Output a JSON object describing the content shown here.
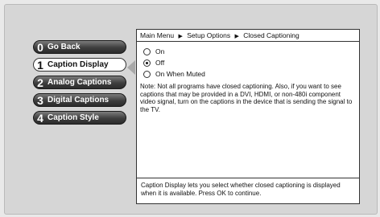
{
  "menu": {
    "items": [
      {
        "number": "0",
        "label": "Go Back"
      },
      {
        "number": "1",
        "label": "Caption Display"
      },
      {
        "number": "2",
        "label": "Analog Captions"
      },
      {
        "number": "3",
        "label": "Digital Captions"
      },
      {
        "number": "4",
        "label": "Caption Style"
      }
    ],
    "selected_index": 1
  },
  "breadcrumb": {
    "items": [
      "Main Menu",
      "Setup Options",
      "Closed Captioning"
    ],
    "separator_icon": "triangle-right-icon"
  },
  "options": {
    "items": [
      {
        "label": "On",
        "selected": false
      },
      {
        "label": "Off",
        "selected": true
      },
      {
        "label": "On When Muted",
        "selected": false
      }
    ]
  },
  "note": "Note: Not all programs have closed captioning. Also, if you want to see captions that may be provided in a DVI, HDMI, or non-480i component video signal, turn on the captions in the device that is sending the signal to the TV.",
  "footer": "Caption Display lets you select whether closed captioning is displayed when it is available. Press OK to continue.",
  "colors": {
    "background": "#d6d6d6",
    "button_dark": "#3e3e3e",
    "button_selected": "#ffffff",
    "panel": "#ffffff"
  }
}
